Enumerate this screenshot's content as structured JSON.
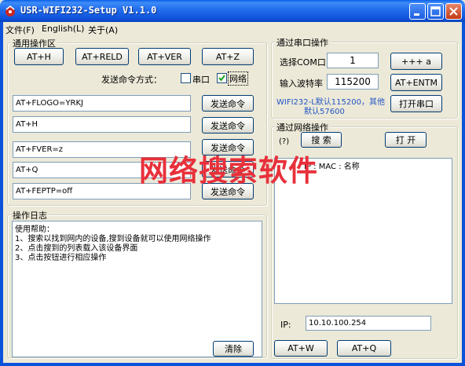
{
  "window": {
    "title": "USR-WIFI232-Setup V1.1.0"
  },
  "menu": [
    "文件(F)",
    "English(L)",
    "关于(A)"
  ],
  "general": {
    "label": "通用操作区",
    "buttons": [
      "AT+H",
      "AT+RELD",
      "AT+VER",
      "AT+Z"
    ],
    "send_mode_label": "发送命令方式：",
    "serial_label": "串口",
    "serial_checked": false,
    "network_label": "网络",
    "network_checked": true,
    "commands": [
      {
        "value": "AT+FLOGO=YRKJ",
        "button": "发送命令"
      },
      {
        "value": "AT+H",
        "button": "发送命令"
      },
      {
        "value": "AT+FVER=z",
        "button": "发送命令"
      },
      {
        "value": "AT+Q",
        "button": "发送命令"
      },
      {
        "value": "AT+FEPTP=off",
        "button": "发送命令"
      }
    ]
  },
  "log": {
    "label": "操作日志",
    "lines": [
      "使用帮助：",
      "1、搜索以找到网内的设备,搜到设备就可以使用网络操作",
      "2、点击搜到的列表载入该设备界面",
      "3、点击按钮进行相应操作"
    ],
    "clear_button": "清除"
  },
  "serial": {
    "label": "通过串口操作",
    "com_label": "选择COM口",
    "com_value": "1",
    "plus_button": "+++ a",
    "baud_label": "输入波特率",
    "baud_value": "115200",
    "entm_button": "AT+ENTM",
    "hint_line1": "WIFI232-L默认115200，其他",
    "hint_line2": "默认57600",
    "open_button": "打开串口"
  },
  "network": {
    "label": "通过网络操作",
    "help": "(?)",
    "search_button": "搜 索",
    "open_button": "打 开",
    "list_header": "IP   :   MAC  :  名称",
    "ip_label": "IP:",
    "ip_value": "10.10.100.254",
    "atw_button": "AT+W",
    "atq_button": "AT+Q"
  },
  "overlay": "网络搜索软件",
  "colors": {
    "titlebar": "#0d52da",
    "overlay_text": "#e8303a",
    "hint_text": "#2255c4",
    "background": "#ece9d8"
  }
}
